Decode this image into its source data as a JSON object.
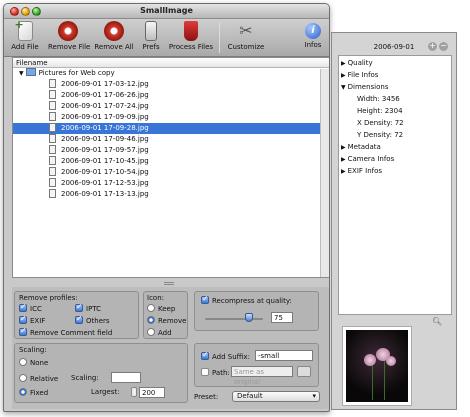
{
  "window": {
    "title": "SmallImage"
  },
  "toolbar": {
    "add_file": "Add File",
    "remove_file": "Remove File",
    "remove_all": "Remove All",
    "prefs": "Prefs",
    "process_files": "Process Files",
    "customize": "Customize",
    "infos": "Infos"
  },
  "filelist": {
    "column_header": "Filename",
    "folder": "Pictures for Web copy",
    "files": [
      "2006-09-01 17-03-12.jpg",
      "2006-09-01 17-06-26.jpg",
      "2006-09-01 17-07-24.jpg",
      "2006-09-01 17-09-09.jpg",
      "2006-09-01 17-09-28.jpg",
      "2006-09-01 17-09-46.jpg",
      "2006-09-01 17-09-57.jpg",
      "2006-09-01 17-10-45.jpg",
      "2006-09-01 17-10-54.jpg",
      "2006-09-01 17-12-53.jpg",
      "2006-09-01 17-13-13.jpg"
    ],
    "selected_index": 4
  },
  "profiles": {
    "title": "Remove profiles:",
    "icc": "ICC",
    "iptc": "IPTC",
    "exif": "EXIF",
    "others": "Others",
    "remove_comment": "Remove Comment field"
  },
  "icon": {
    "title": "Icon:",
    "keep": "Keep",
    "remove": "Remove",
    "add": "Add"
  },
  "recompress": {
    "label": "Recompress at quality:",
    "quality": "75",
    "quality_fraction": 0.75
  },
  "scaling": {
    "title": "Scaling:",
    "none": "None",
    "relative": "Relative",
    "scaling_label": "Scaling:",
    "scaling_value": "",
    "fixed": "Fixed",
    "largest_label": "Largest:",
    "largest_value": "200"
  },
  "suffix": {
    "label": "Add Suffix:",
    "value": "-small"
  },
  "path": {
    "label": "Path:",
    "placeholder": "Same as original"
  },
  "preset": {
    "label": "Preset:",
    "value": "Default"
  },
  "drawer": {
    "title": "2006-09-01",
    "items": [
      {
        "label": "Quality",
        "open": false
      },
      {
        "label": "File Infos",
        "open": false
      },
      {
        "label": "Dimensions",
        "open": true
      },
      {
        "label": "Metadata",
        "open": false
      },
      {
        "label": "Camera Infos",
        "open": false
      },
      {
        "label": "EXIF Infos",
        "open": false
      }
    ],
    "dimensions": {
      "width": "Width: 3456",
      "height": "Height: 2304",
      "xdensity": "X Density: 72",
      "ydensity": "Y Density: 72"
    }
  },
  "colors": {
    "selection": "#3875d7",
    "accent": "#3a78d8"
  }
}
